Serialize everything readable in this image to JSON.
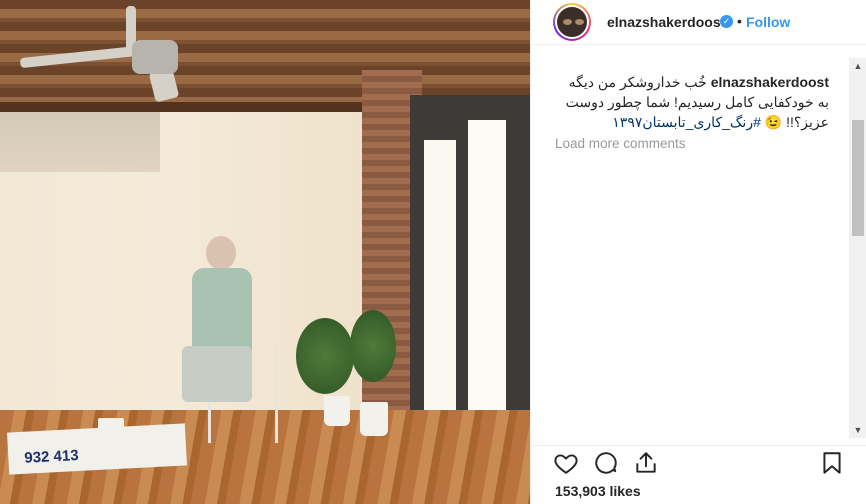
{
  "post": {
    "username": "elnazshakerdoost",
    "verified_badge": "✓",
    "dot": "•",
    "follow_label": "Follow",
    "caption_user": "elnazshakerdoost",
    "caption_text": "خُب خداروشکر من دیگه به خودکفایی کامل رسیدیم! شما چطور دوست عزیز؟!! 😉",
    "caption_hashtag": "#رنگ_کاری_تابستان۱۳۹۷",
    "load_more_label": "Load more comments",
    "likes_label": "153,903 likes"
  },
  "photo": {
    "sign_text": "932 413"
  },
  "icons": {
    "like": "heart-icon",
    "comment": "comment-icon",
    "share": "share-icon",
    "save": "bookmark-icon"
  },
  "scrollbar": {
    "up": "▲",
    "down": "▼"
  },
  "colors": {
    "accent": "#3897f0",
    "text": "#262626",
    "muted": "#999999",
    "hashtag": "#003569"
  }
}
